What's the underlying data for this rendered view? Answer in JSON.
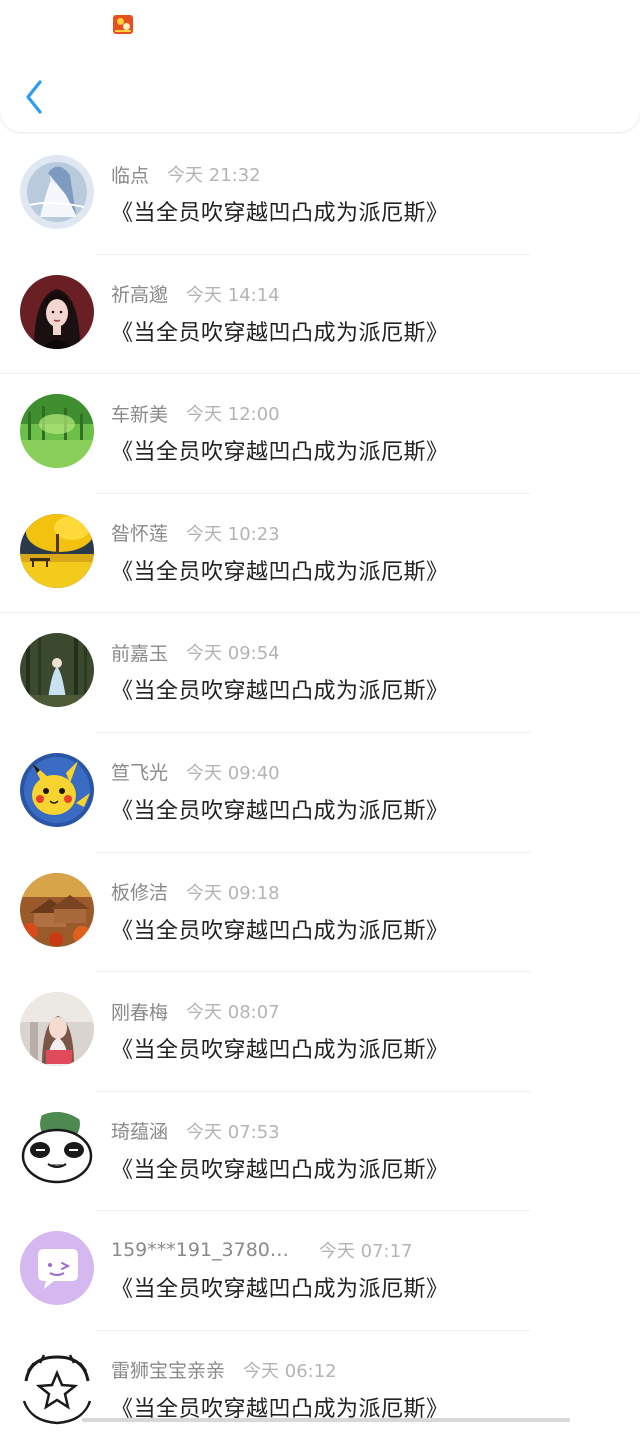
{
  "header": {
    "app_icon": "app-logo-icon",
    "back_icon": "chevron-left-icon",
    "accent": "#2b9cf2"
  },
  "messages": [
    {
      "name": "临点",
      "time": "今天 21:32",
      "title": "《当全员吹穿越凹凸成为派厄斯》",
      "avatar": "anime-girl-blue"
    },
    {
      "name": "祈高邈",
      "time": "今天 14:14",
      "title": "《当全员吹穿越凹凸成为派厄斯》",
      "avatar": "dark-hair-girl"
    },
    {
      "name": "车新美",
      "time": "今天 12:00",
      "title": "《当全员吹穿越凹凸成为派厄斯》",
      "avatar": "green-forest"
    },
    {
      "name": "昝怀莲",
      "time": "今天 10:23",
      "title": "《当全员吹穿越凹凸成为派厄斯》",
      "avatar": "yellow-tree-bench"
    },
    {
      "name": "前嘉玉",
      "time": "今天 09:54",
      "title": "《当全员吹穿越凹凸成为派厄斯》",
      "avatar": "forest-girl-white-dress"
    },
    {
      "name": "笪飞光",
      "time": "今天 09:40",
      "title": "《当全员吹穿越凹凸成为派厄斯》",
      "avatar": "pikachu"
    },
    {
      "name": "板修洁",
      "time": "今天 09:18",
      "title": "《当全员吹穿越凹凸成为派厄斯》",
      "avatar": "autumn-village"
    },
    {
      "name": "刚春梅",
      "time": "今天 08:07",
      "title": "《当全员吹穿越凹凸成为派厄斯》",
      "avatar": "girl-photo"
    },
    {
      "name": "琦蕴涵",
      "time": "今天 07:53",
      "title": "《当全员吹穿越凹凸成为派厄斯》",
      "avatar": "panda"
    },
    {
      "name": "159***191_3780…",
      "time": "今天 07:17",
      "title": "《当全员吹穿越凹凸成为派厄斯》",
      "avatar": "purple-chat-bubble"
    },
    {
      "name": "雷狮宝宝亲亲",
      "time": "今天 06:12",
      "title": "《当全员吹穿越凹凸成为派厄斯》",
      "avatar": "star-sketch"
    }
  ]
}
